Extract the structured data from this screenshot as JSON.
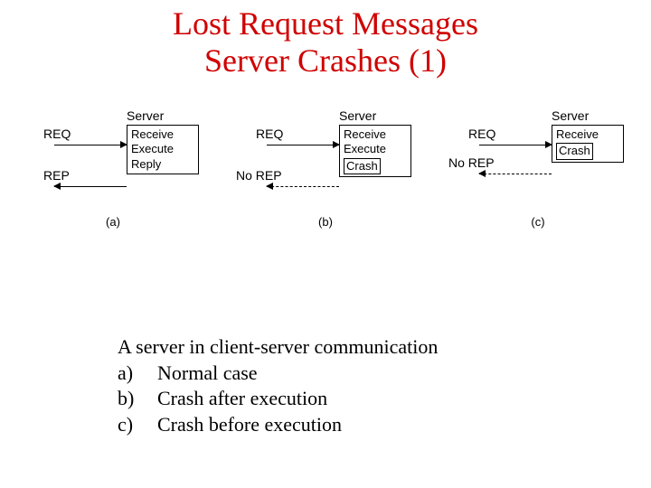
{
  "title_line1": "Lost Request Messages",
  "title_line2": "Server Crashes (1)",
  "server_label": "Server",
  "req_label": "REQ",
  "rep_label": "REP",
  "norep_label": "No REP",
  "steps": {
    "receive": "Receive",
    "execute": "Execute",
    "reply": "Reply",
    "crash": "Crash"
  },
  "sub": {
    "a": "(a)",
    "b": "(b)",
    "c": "(c)"
  },
  "caption_intro": "A server in client-server communication",
  "caption_items": [
    {
      "key": "a)",
      "text": "Normal case"
    },
    {
      "key": "b)",
      "text": "Crash after execution"
    },
    {
      "key": "c)",
      "text": "Crash before execution"
    }
  ]
}
